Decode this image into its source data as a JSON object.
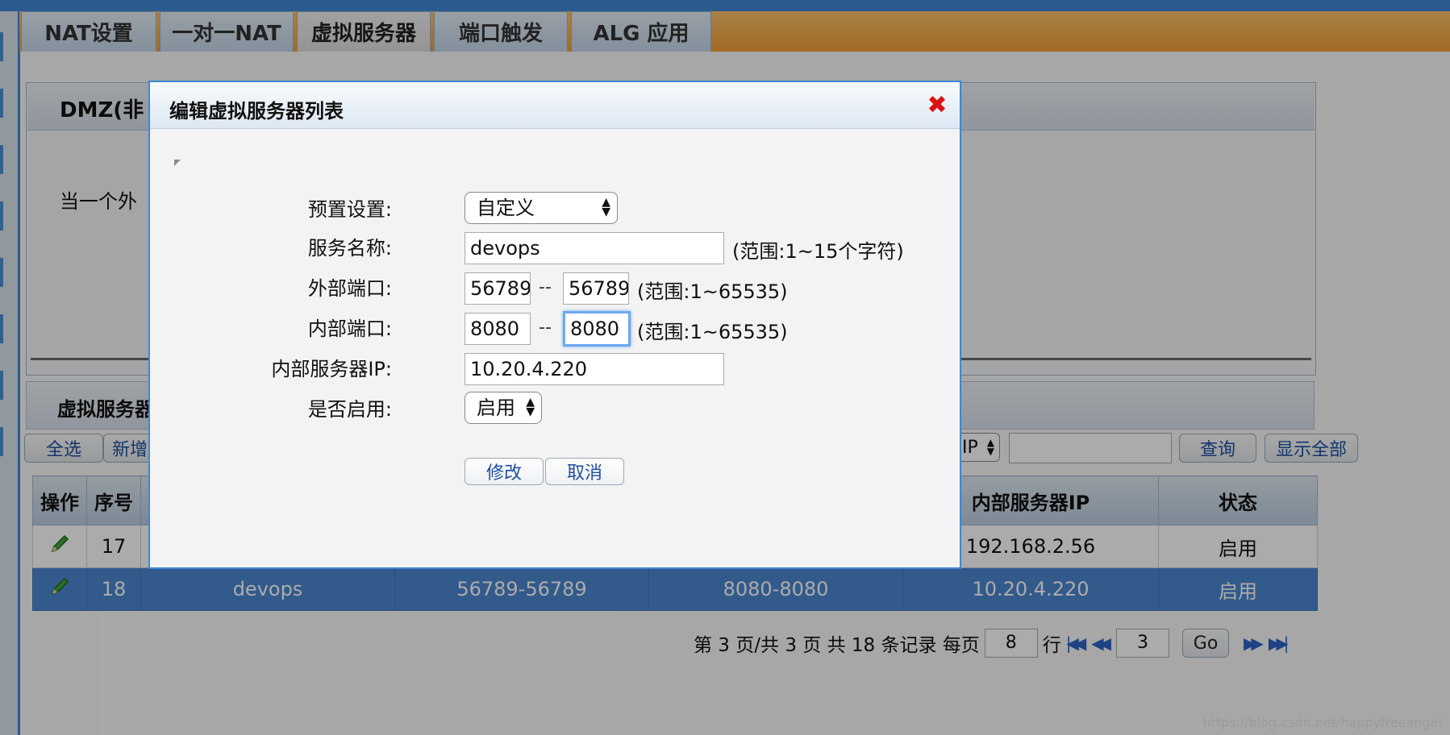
{
  "tabs": [
    {
      "label": "NAT设置"
    },
    {
      "label": "一对一NAT"
    },
    {
      "label": "虚拟服务器"
    },
    {
      "label": "端口触发"
    },
    {
      "label": "ALG 应用"
    }
  ],
  "dmz": {
    "title": "DMZ(非",
    "description": "当一个外"
  },
  "vs_section": {
    "title": "虚拟服务器"
  },
  "toolbar": {
    "select_all": "全选",
    "new": "新增",
    "filter_value": "IP",
    "search": "查询",
    "show_all": "显示全部"
  },
  "table": {
    "headers": [
      "操作",
      "序号",
      "",
      "",
      "",
      "内部服务器IP",
      "状态"
    ],
    "rows": [
      {
        "index": "17",
        "name": "",
        "ext_port": "",
        "int_port": "",
        "ip": "192.168.2.56",
        "status": "启用"
      },
      {
        "index": "18",
        "name": "devops",
        "ext_port": "56789-56789",
        "int_port": "8080-8080",
        "ip": "10.20.4.220",
        "status": "启用"
      }
    ]
  },
  "pager": {
    "text": "第 3 页/共 3 页 共 18 条记录 每页",
    "per_page": "8",
    "rows_label": "行",
    "page": "3",
    "go": "Go"
  },
  "dialog": {
    "title": "编辑虚拟服务器列表",
    "close_glyph": "✖",
    "fields": {
      "preset_label": "预置设置:",
      "preset_value": "自定义",
      "name_label": "服务名称:",
      "name_value": "devops",
      "name_hint": "(范围:1~15个字符)",
      "ext_label": "外部端口:",
      "ext_from": "56789",
      "ext_to": "56789",
      "ext_hint": "(范围:1~65535)",
      "int_label": "内部端口:",
      "int_from": "8080",
      "int_to": "8080",
      "int_hint": "(范围:1~65535)",
      "ip_label": "内部服务器IP:",
      "ip_value": "10.20.4.220",
      "enable_label": "是否启用:",
      "enable_value": "启用"
    },
    "dash": "--",
    "modify": "修改",
    "cancel": "取消"
  },
  "watermark": "https://blog.csdn.net/happyfreeangel",
  "colors": {
    "accent_blue": "#3f86d4",
    "tab_orange": "#f2a035",
    "selected_row": "#4b86d0",
    "close_red": "#dd1111"
  }
}
